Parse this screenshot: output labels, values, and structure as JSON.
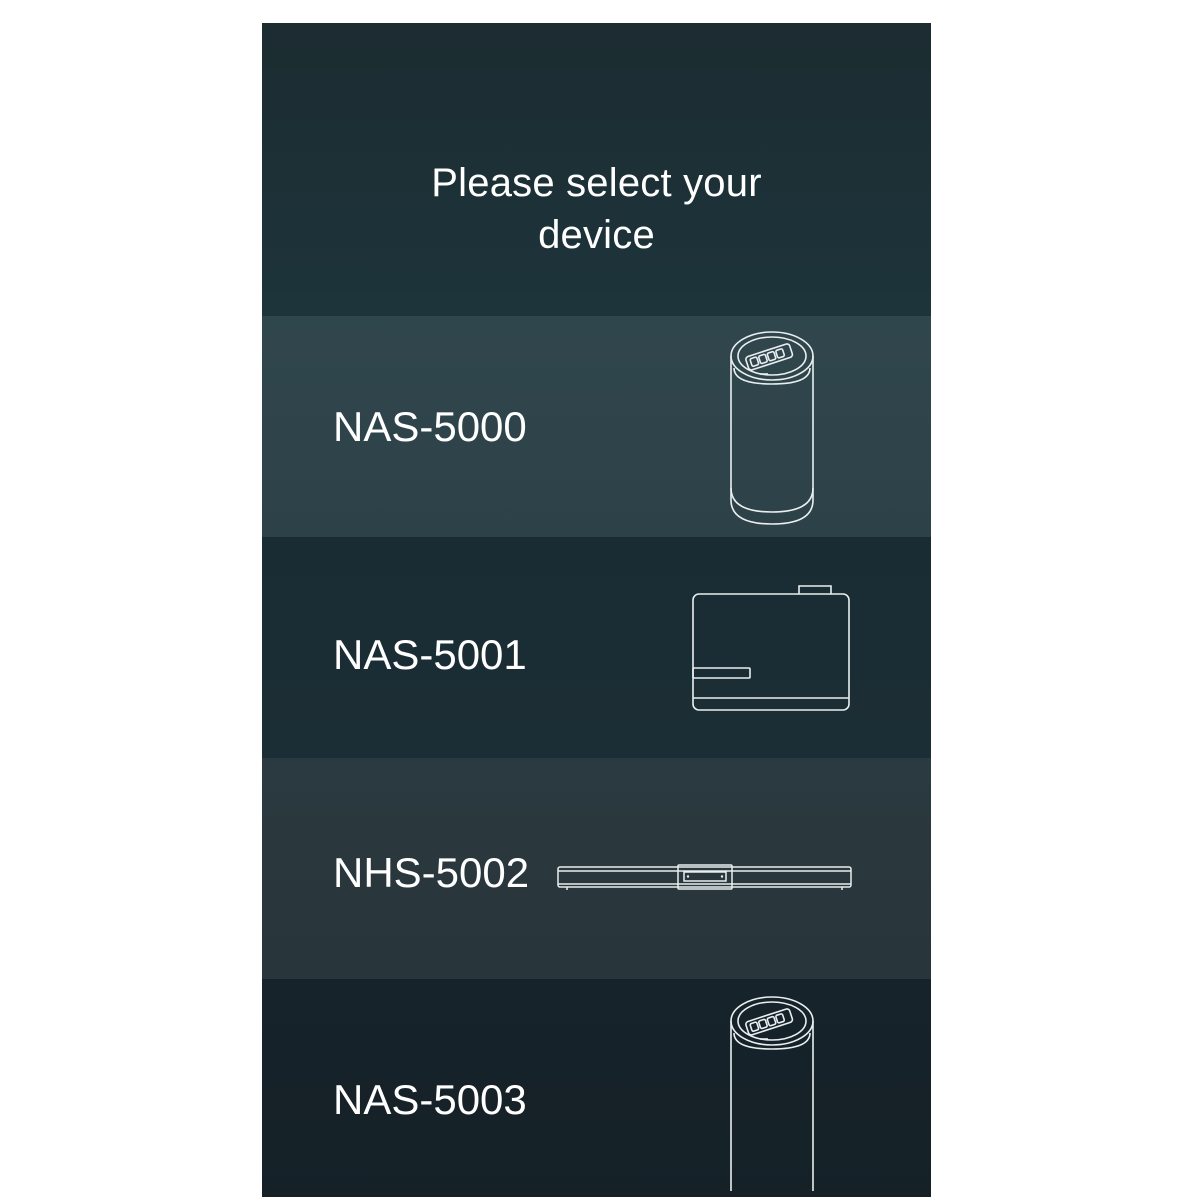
{
  "header": {
    "title_line1": "Please select your",
    "title_line2": "device"
  },
  "devices": [
    {
      "label": "NAS-5000",
      "icon": "cylinder-nas-icon"
    },
    {
      "label": "NAS-5001",
      "icon": "box-nas-icon"
    },
    {
      "label": "NHS-5002",
      "icon": "slim-bar-nas-icon"
    },
    {
      "label": "NAS-5003",
      "icon": "cylinder-nas-icon"
    }
  ],
  "colors": {
    "header_bg": "#1d3036",
    "row_light": "#2f454b",
    "row_dark": "#1b2d33",
    "row_mid": "#29373c",
    "row_darkest": "#152228",
    "text": "#ffffff",
    "outline": "#e6eaeb"
  }
}
